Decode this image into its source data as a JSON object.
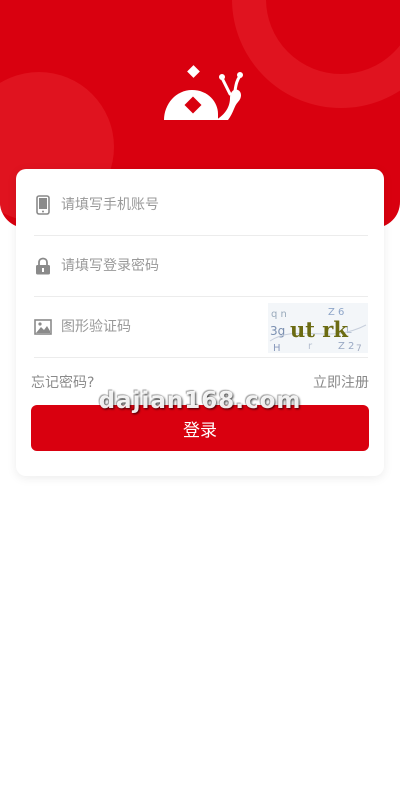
{
  "colors": {
    "brand_red": "#d9000f",
    "placeholder_gray": "#999999",
    "link_gray": "#8a8a8a"
  },
  "header": {
    "logo_icon": "snail-logo-icon"
  },
  "form": {
    "phone": {
      "icon": "phone-icon",
      "placeholder": "请填写手机账号",
      "value": ""
    },
    "password": {
      "icon": "lock-icon",
      "placeholder": "请填写登录密码",
      "value": ""
    },
    "captcha": {
      "icon": "image-icon",
      "placeholder": "图形验证码",
      "value": "",
      "image_text": "ut rk"
    },
    "forgot_password": "忘记密码?",
    "register": "立即注册",
    "login_button": "登录"
  },
  "watermark": "dajian168.com"
}
